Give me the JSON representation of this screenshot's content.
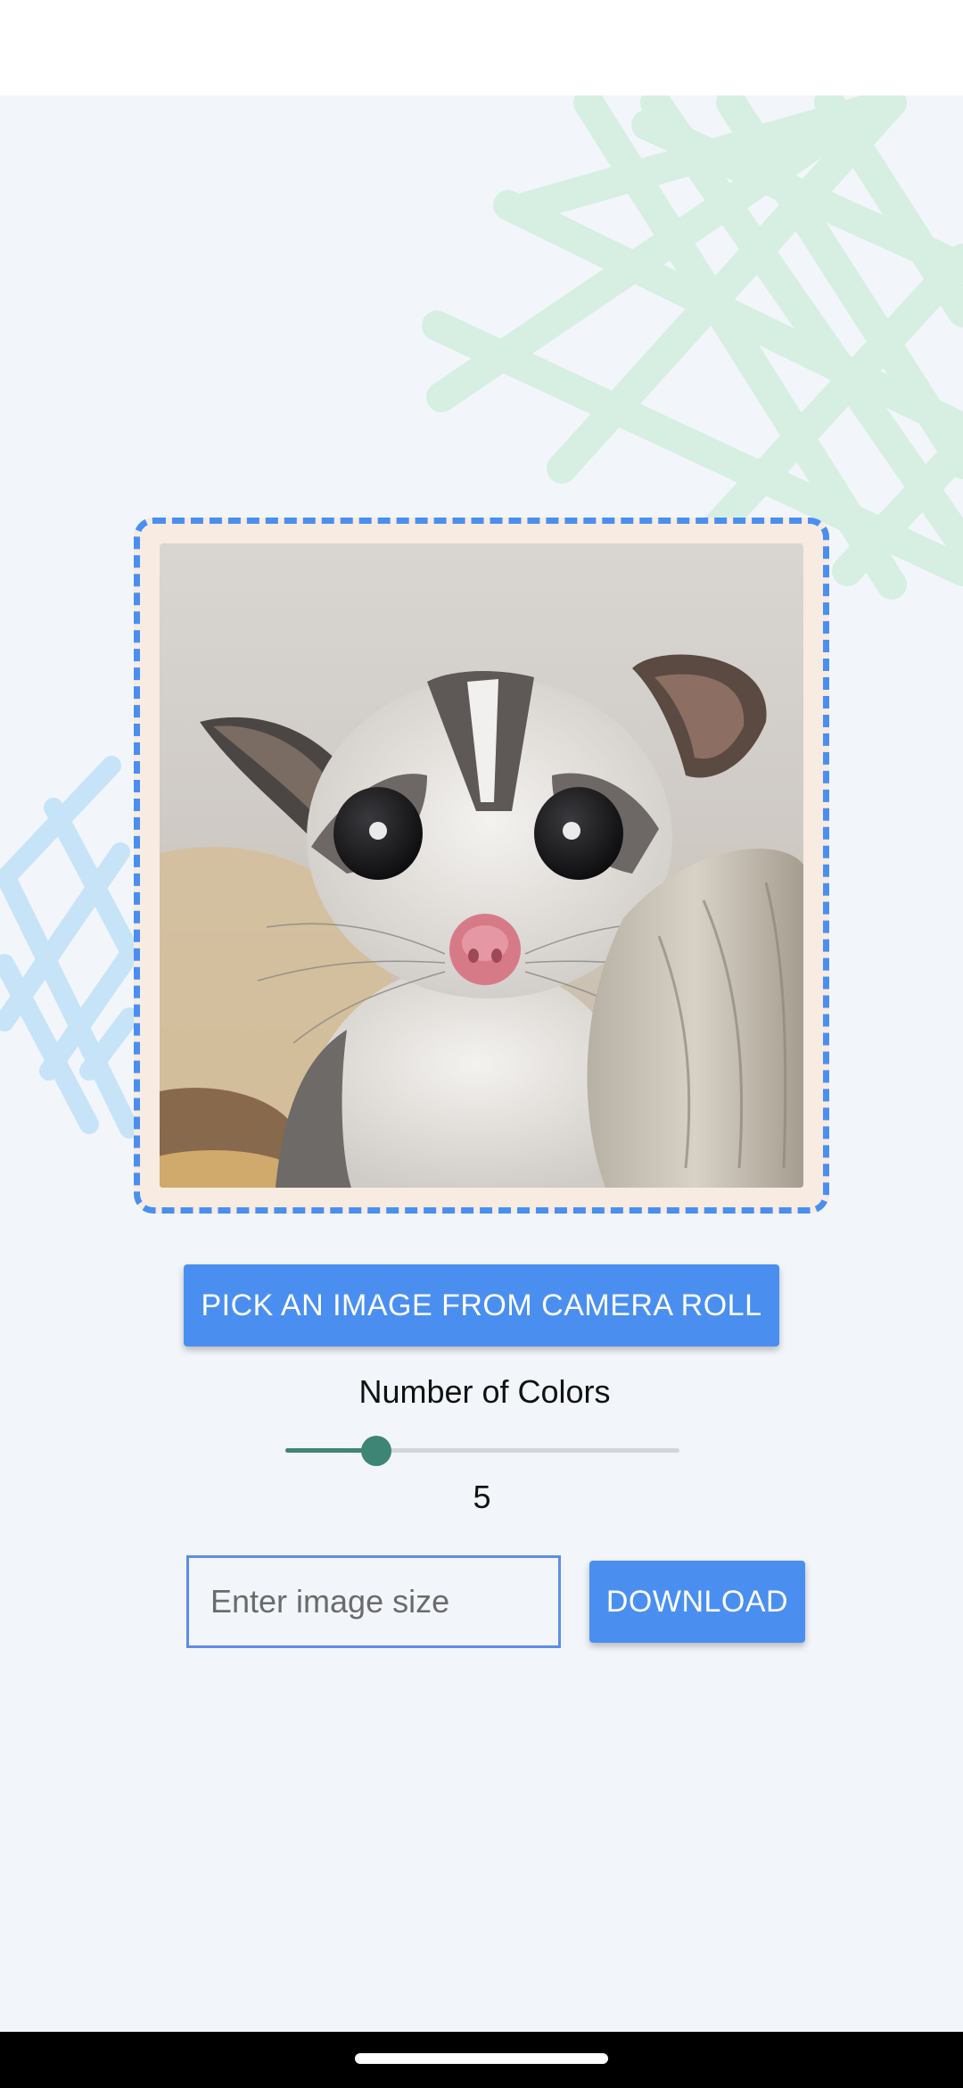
{
  "photo": {
    "subject": "sugar glider photo"
  },
  "actions": {
    "pick_label": "PICK AN IMAGE FROM CAMERA ROLL",
    "download_label": "DOWNLOAD"
  },
  "colors": {
    "label": "Number of Colors",
    "value": "5",
    "slider_fraction": 0.23
  },
  "size_input": {
    "value": "",
    "placeholder": "Enter image size"
  },
  "theme": {
    "accent": "#4a8ff0",
    "slider": "#3e8575",
    "background": "#f2f6fa",
    "pattern_green": "#d6efe2",
    "pattern_blue": "#c7e3f8"
  },
  "icons": [
    "home-handle"
  ]
}
